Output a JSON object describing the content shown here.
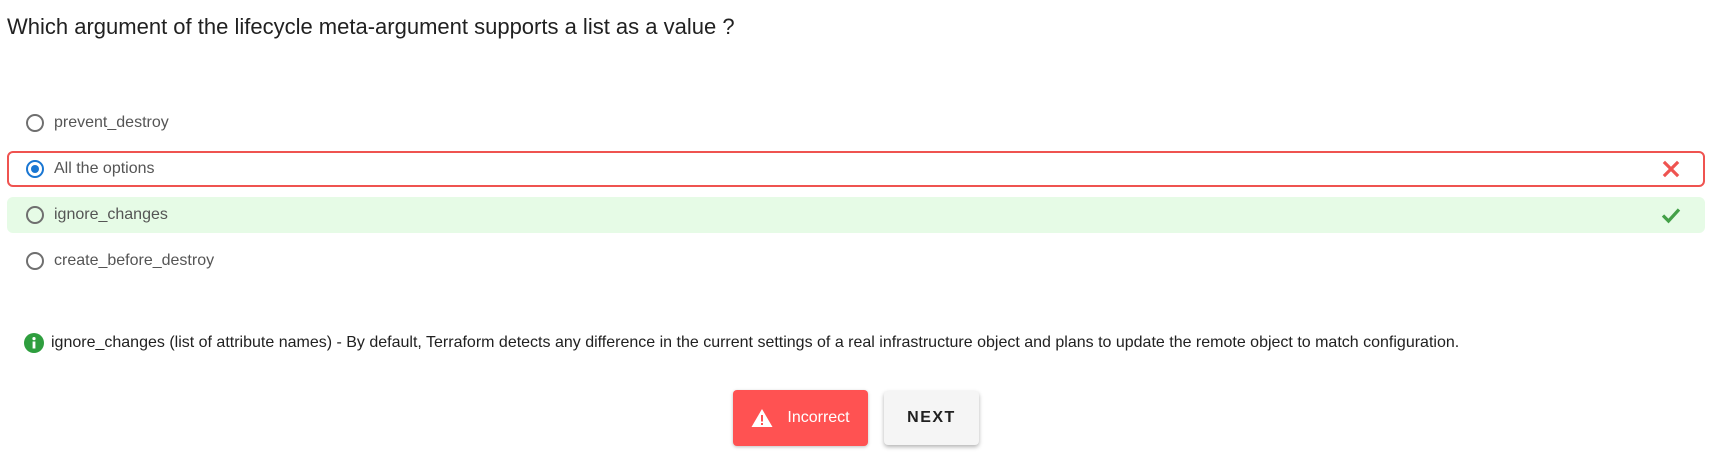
{
  "question": "Which argument of the lifecycle meta-argument supports a list as a value ?",
  "options": [
    {
      "label": "prevent_destroy",
      "selected": false,
      "status": "none"
    },
    {
      "label": "All the options",
      "selected": true,
      "status": "wrong"
    },
    {
      "label": "ignore_changes",
      "selected": false,
      "status": "correct"
    },
    {
      "label": "create_before_destroy",
      "selected": false,
      "status": "none"
    }
  ],
  "explanation": {
    "icon": "info-icon",
    "text": "ignore_changes (list of attribute names) - By default, Terraform detects any difference in the current settings of a real infrastructure object and plans to update the remote object to match configuration."
  },
  "buttons": {
    "result_label": "Incorrect",
    "result_icon": "warning-icon",
    "next_label": "NEXT"
  },
  "colors": {
    "wrong": "#ef5350",
    "correct": "#43a047",
    "correct_bg": "#e6fbe6",
    "selected_radio": "#1976d2",
    "incorrect_button": "#ff5252"
  }
}
